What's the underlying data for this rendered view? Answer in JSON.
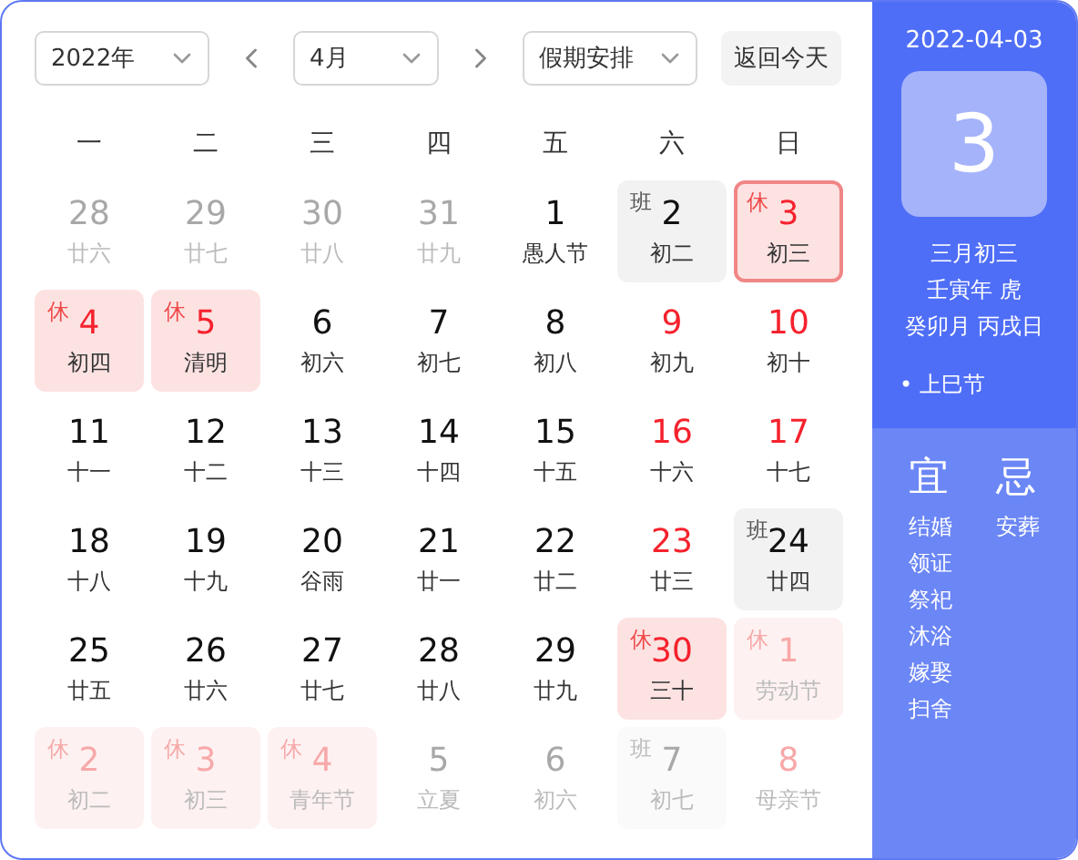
{
  "toolbar": {
    "year_select": {
      "value": "2022年"
    },
    "month_select": {
      "value": "4月"
    },
    "holiday_select": {
      "value": "假期安排"
    },
    "today_button": {
      "label": "返回今天"
    }
  },
  "weekdays": [
    "一",
    "二",
    "三",
    "四",
    "五",
    "六",
    "日"
  ],
  "weeks": [
    [
      {
        "day": "28",
        "sub": "廿六",
        "other_month": true,
        "red": false,
        "kind": "normal",
        "selected": false
      },
      {
        "day": "29",
        "sub": "廿七",
        "other_month": true,
        "red": false,
        "kind": "normal",
        "selected": false
      },
      {
        "day": "30",
        "sub": "廿八",
        "other_month": true,
        "red": false,
        "kind": "normal",
        "selected": false
      },
      {
        "day": "31",
        "sub": "廿九",
        "other_month": true,
        "red": false,
        "kind": "normal",
        "selected": false
      },
      {
        "day": "1",
        "sub": "愚人节",
        "other_month": false,
        "red": false,
        "kind": "normal",
        "selected": false
      },
      {
        "day": "2",
        "sub": "初二",
        "other_month": false,
        "red": false,
        "kind": "work",
        "badge": "班",
        "selected": false
      },
      {
        "day": "3",
        "sub": "初三",
        "other_month": false,
        "red": true,
        "kind": "rest",
        "badge": "休",
        "selected": true
      }
    ],
    [
      {
        "day": "4",
        "sub": "初四",
        "other_month": false,
        "red": true,
        "kind": "rest",
        "badge": "休",
        "selected": false
      },
      {
        "day": "5",
        "sub": "清明",
        "other_month": false,
        "red": true,
        "kind": "rest",
        "badge": "休",
        "selected": false
      },
      {
        "day": "6",
        "sub": "初六",
        "other_month": false,
        "red": false,
        "kind": "normal",
        "selected": false
      },
      {
        "day": "7",
        "sub": "初七",
        "other_month": false,
        "red": false,
        "kind": "normal",
        "selected": false
      },
      {
        "day": "8",
        "sub": "初八",
        "other_month": false,
        "red": false,
        "kind": "normal",
        "selected": false
      },
      {
        "day": "9",
        "sub": "初九",
        "other_month": false,
        "red": true,
        "kind": "normal",
        "selected": false
      },
      {
        "day": "10",
        "sub": "初十",
        "other_month": false,
        "red": true,
        "kind": "normal",
        "selected": false
      }
    ],
    [
      {
        "day": "11",
        "sub": "十一",
        "other_month": false,
        "red": false,
        "kind": "normal",
        "selected": false
      },
      {
        "day": "12",
        "sub": "十二",
        "other_month": false,
        "red": false,
        "kind": "normal",
        "selected": false
      },
      {
        "day": "13",
        "sub": "十三",
        "other_month": false,
        "red": false,
        "kind": "normal",
        "selected": false
      },
      {
        "day": "14",
        "sub": "十四",
        "other_month": false,
        "red": false,
        "kind": "normal",
        "selected": false
      },
      {
        "day": "15",
        "sub": "十五",
        "other_month": false,
        "red": false,
        "kind": "normal",
        "selected": false
      },
      {
        "day": "16",
        "sub": "十六",
        "other_month": false,
        "red": true,
        "kind": "normal",
        "selected": false
      },
      {
        "day": "17",
        "sub": "十七",
        "other_month": false,
        "red": true,
        "kind": "normal",
        "selected": false
      }
    ],
    [
      {
        "day": "18",
        "sub": "十八",
        "other_month": false,
        "red": false,
        "kind": "normal",
        "selected": false
      },
      {
        "day": "19",
        "sub": "十九",
        "other_month": false,
        "red": false,
        "kind": "normal",
        "selected": false
      },
      {
        "day": "20",
        "sub": "谷雨",
        "other_month": false,
        "red": false,
        "kind": "normal",
        "selected": false
      },
      {
        "day": "21",
        "sub": "廿一",
        "other_month": false,
        "red": false,
        "kind": "normal",
        "selected": false
      },
      {
        "day": "22",
        "sub": "廿二",
        "other_month": false,
        "red": false,
        "kind": "normal",
        "selected": false
      },
      {
        "day": "23",
        "sub": "廿三",
        "other_month": false,
        "red": true,
        "kind": "normal",
        "selected": false
      },
      {
        "day": "24",
        "sub": "廿四",
        "other_month": false,
        "red": false,
        "kind": "work",
        "badge": "班",
        "selected": false
      }
    ],
    [
      {
        "day": "25",
        "sub": "廿五",
        "other_month": false,
        "red": false,
        "kind": "normal",
        "selected": false
      },
      {
        "day": "26",
        "sub": "廿六",
        "other_month": false,
        "red": false,
        "kind": "normal",
        "selected": false
      },
      {
        "day": "27",
        "sub": "廿七",
        "other_month": false,
        "red": false,
        "kind": "normal",
        "selected": false
      },
      {
        "day": "28",
        "sub": "廿八",
        "other_month": false,
        "red": false,
        "kind": "normal",
        "selected": false
      },
      {
        "day": "29",
        "sub": "廿九",
        "other_month": false,
        "red": false,
        "kind": "normal",
        "selected": false
      },
      {
        "day": "30",
        "sub": "三十",
        "other_month": false,
        "red": true,
        "kind": "rest",
        "badge": "休",
        "selected": false
      },
      {
        "day": "1",
        "sub": "劳动节",
        "other_month": true,
        "red": true,
        "kind": "rest",
        "badge": "休",
        "selected": false
      }
    ],
    [
      {
        "day": "2",
        "sub": "初二",
        "other_month": true,
        "red": true,
        "kind": "rest",
        "badge": "休",
        "selected": false
      },
      {
        "day": "3",
        "sub": "初三",
        "other_month": true,
        "red": true,
        "kind": "rest",
        "badge": "休",
        "selected": false
      },
      {
        "day": "4",
        "sub": "青年节",
        "other_month": true,
        "red": true,
        "kind": "rest",
        "badge": "休",
        "selected": false
      },
      {
        "day": "5",
        "sub": "立夏",
        "other_month": true,
        "red": false,
        "kind": "normal",
        "selected": false
      },
      {
        "day": "6",
        "sub": "初六",
        "other_month": true,
        "red": false,
        "kind": "normal",
        "selected": false
      },
      {
        "day": "7",
        "sub": "初七",
        "other_month": true,
        "red": false,
        "kind": "work",
        "badge": "班",
        "selected": false
      },
      {
        "day": "8",
        "sub": "母亲节",
        "other_month": true,
        "red": true,
        "kind": "normal",
        "selected": false
      }
    ]
  ],
  "side": {
    "date": "2022-04-03",
    "big_day": "3",
    "lunar_lines": [
      "三月初三",
      "壬寅年 虎",
      "癸卯月 丙戌日"
    ],
    "festivals": [
      "• 上巳节"
    ],
    "yi": {
      "title": "宜",
      "items": [
        "结婚",
        "领证",
        "祭祀",
        "沐浴",
        "嫁娶",
        "扫舍"
      ]
    },
    "ji": {
      "title": "忌",
      "items": [
        "安葬"
      ]
    }
  }
}
